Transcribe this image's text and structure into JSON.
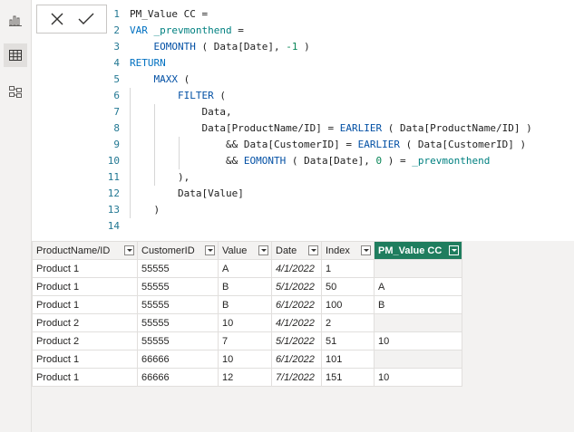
{
  "formula": {
    "lines": [
      {
        "n": "1",
        "html": "PM_Value CC ="
      },
      {
        "n": "2",
        "html": "<span class=\"kw\">VAR</span> <span class=\"var\">_prevmonthend</span> ="
      },
      {
        "n": "3",
        "html": "    <span class=\"fn\">EOMONTH</span> ( Data[Date], <span class=\"num\">-1</span> )"
      },
      {
        "n": "4",
        "html": "<span class=\"kw\">RETURN</span>"
      },
      {
        "n": "5",
        "html": "    <span class=\"fn\">MAXX</span> ("
      },
      {
        "n": "6",
        "html": "        <span class=\"fn\">FILTER</span> ("
      },
      {
        "n": "7",
        "html": "            Data,"
      },
      {
        "n": "8",
        "html": "            Data[ProductName/ID] = <span class=\"fn\">EARLIER</span> ( Data[ProductName/ID] )"
      },
      {
        "n": "9",
        "html": "                &amp;&amp; Data[CustomerID] = <span class=\"fn\">EARLIER</span> ( Data[CustomerID] )"
      },
      {
        "n": "10",
        "html": "                &amp;&amp; <span class=\"fn\">EOMONTH</span> ( Data[Date], <span class=\"num\">0</span> ) = <span class=\"var\">_prevmonthend</span>"
      },
      {
        "n": "11",
        "html": "        ),"
      },
      {
        "n": "12",
        "html": "        Data[Value]"
      },
      {
        "n": "13",
        "html": "    )"
      },
      {
        "n": "14",
        "html": ""
      }
    ]
  },
  "table": {
    "columns": [
      "ProductName/ID",
      "CustomerID",
      "Value",
      "Date",
      "Index",
      "PM_Value CC"
    ],
    "rows": [
      [
        "Product 1",
        "55555",
        "A",
        "4/1/2022",
        "1",
        ""
      ],
      [
        "Product 1",
        "55555",
        "B",
        "5/1/2022",
        "50",
        "A"
      ],
      [
        "Product 1",
        "55555",
        "B",
        "6/1/2022",
        "100",
        "B"
      ],
      [
        "Product 2",
        "55555",
        "10",
        "4/1/2022",
        "2",
        ""
      ],
      [
        "Product 2",
        "55555",
        "7",
        "5/1/2022",
        "51",
        "10"
      ],
      [
        "Product 1",
        "66666",
        "10",
        "6/1/2022",
        "101",
        ""
      ],
      [
        "Product 1",
        "66666",
        "12",
        "7/1/2022",
        "151",
        "10"
      ]
    ]
  },
  "colors": {
    "selected_header": "#1f7d5e",
    "keyword": "#0070c1",
    "function": "#0451a5",
    "number": "#098658",
    "variable": "#008080",
    "line_number": "#237893"
  }
}
